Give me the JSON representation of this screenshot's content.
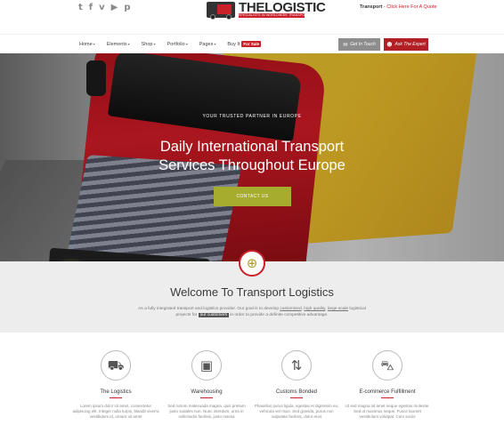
{
  "topbar": {
    "social": [
      "t",
      "f",
      "v",
      "▶",
      "p"
    ],
    "social_names": [
      "tumblr-icon",
      "facebook-icon",
      "vimeo-icon",
      "youtube-icon",
      "pinterest-icon"
    ],
    "brand": "THELOGISTIC",
    "tagline": "SPECIALISTS IN WORLDWIDE TRANSPORT",
    "quote_prefix": "Transport",
    "quote_sep": " - ",
    "quote_link": "Click Here",
    "quote_suffix": " For A Quote"
  },
  "nav": {
    "items": [
      {
        "label": "Home",
        "caret": "▾"
      },
      {
        "label": "Elements",
        "caret": "▾"
      },
      {
        "label": "Shop",
        "caret": "▾"
      },
      {
        "label": "Portfolio",
        "caret": "▾"
      },
      {
        "label": "Pages",
        "caret": "▾"
      },
      {
        "label": "Buy It",
        "badge": "For Sale"
      }
    ],
    "btn_touch": "Get In Touch",
    "btn_expert": "Ask The Expert"
  },
  "hero": {
    "eyebrow": "YOUR TRUSTED PARTNER IN EUROPE",
    "headline_1": "Daily International Transport",
    "headline_2": "Services Throughout Europe",
    "cta": "CONTACT US"
  },
  "welcome": {
    "title": "Welcome To Transport Logistics",
    "intro_1": "As a fully integrated transport and logistics provider. Our goal is to develop ",
    "intro_u1": "customized",
    "intro_2": ", ",
    "intro_u2": "high quality",
    "intro_3": ", ",
    "intro_u3": "large scale",
    "intro_4": " logistical projects for ",
    "intro_hl": "our customers",
    "intro_5": " in order to provide a definite competitive advantage."
  },
  "services": [
    {
      "title": "The Logistics",
      "icon": "truck-icon",
      "glyph": "⛟",
      "text": "Lorem ipsum dolor sit amet, consectetur adipiscing elit. Integer nulla turpis, blandit viverra vestibulum id, ornare sit amet"
    },
    {
      "title": "Warehousing",
      "icon": "box-icon",
      "glyph": "▣",
      "text": "Sed rutrum malesuada magna, quis pretium justo sodales non. Nunc interdum, urna in sollicitudin facilisis, justo massa"
    },
    {
      "title": "Customs Bonded",
      "icon": "road-sign-icon",
      "glyph": "⇅",
      "text": "Phasellus purus ligula, egestas et dignissim eu, vehicula vel risus. Sed gravida, purus non vulputate facilisis, dolor eros"
    },
    {
      "title": "E-commerce Fulfillment",
      "icon": "shopping-cart-icon",
      "glyph": "⛍",
      "text": "Ut sed magna sit amet neque egestas molestie. Sed ut maximus neque. Fusce laoreet vestibulum volutpat. Cum sociis"
    }
  ]
}
